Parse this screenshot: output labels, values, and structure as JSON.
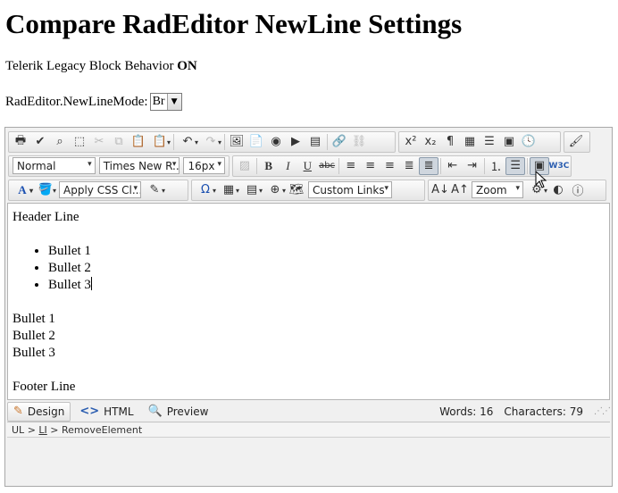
{
  "page": {
    "title": "Compare RadEditor NewLine Settings",
    "legacy_prefix": "Telerik Legacy Block Behavior",
    "legacy_state": "ON",
    "mode_label": "RadEditor.NewLineMode:",
    "mode_value": "Br"
  },
  "toolbar": {
    "paragraph_style": "Normal",
    "font_name": "Times New R...",
    "font_size": "16px",
    "apply_css": "Apply CSS Cl...",
    "custom_links": "Custom Links",
    "zoom": "Zoom"
  },
  "content": {
    "header_line": "Header Line",
    "bullets": [
      "Bullet 1",
      "Bullet 2",
      "Bullet 3"
    ],
    "lines": [
      "Bullet 1",
      "Bullet 2",
      "Bullet 3"
    ],
    "footer_line": "Footer Line"
  },
  "modes": {
    "design": "Design",
    "html": "HTML",
    "preview": "Preview"
  },
  "stats": {
    "words": "Words: 16",
    "characters": "Characters: 79"
  },
  "path": {
    "ul": "UL",
    "li": "LI",
    "sep": ">",
    "action": "RemoveElement"
  },
  "colors": {
    "toolbar_bg": "#e6e6e6",
    "active_button": "#cfd6de",
    "editor_border": "#a8a8a8"
  }
}
